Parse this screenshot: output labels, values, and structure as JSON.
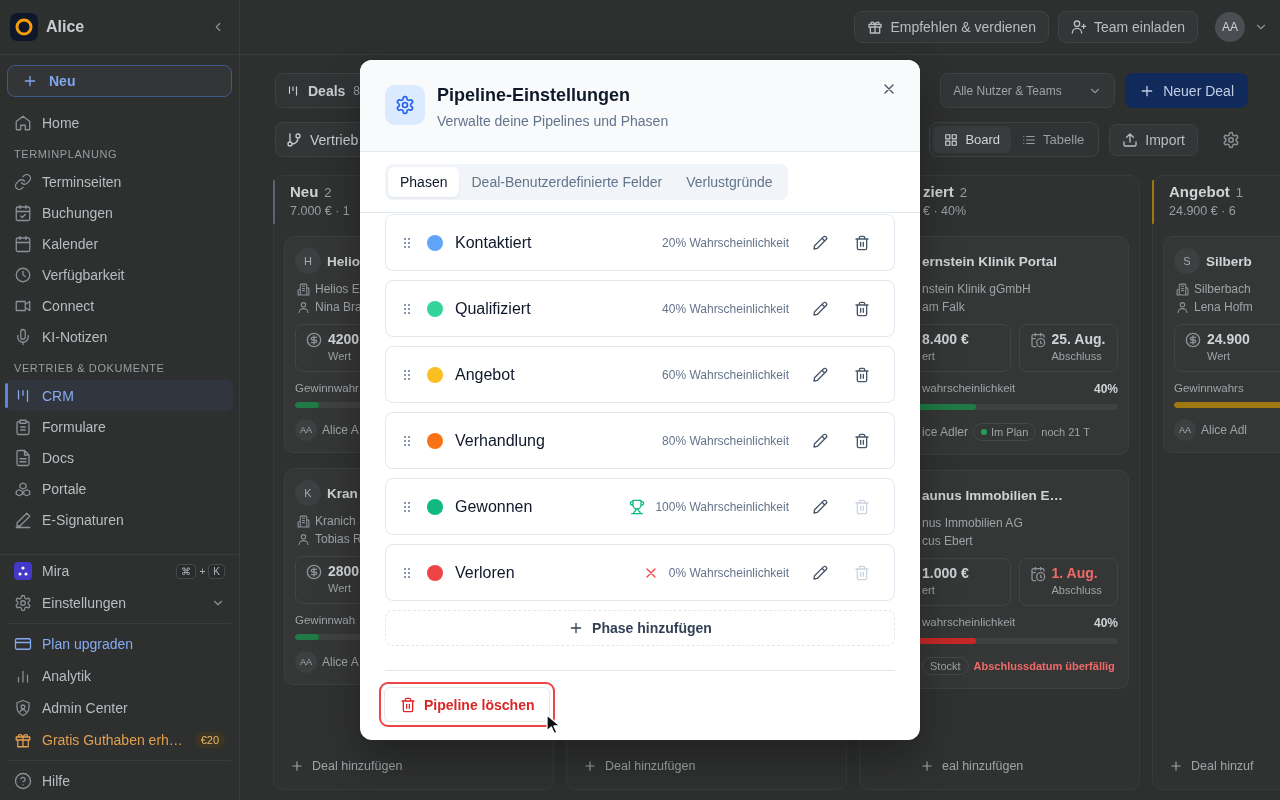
{
  "sidebar": {
    "workspace": "Alice",
    "new_button": "Neu",
    "groups": [
      {
        "items": [
          {
            "label": "Home",
            "selected": false
          }
        ]
      },
      {
        "heading": "TERMINPLANUNG",
        "items": [
          {
            "label": "Terminseiten",
            "selected": false
          },
          {
            "label": "Buchungen",
            "selected": false
          },
          {
            "label": "Kalender",
            "selected": false
          },
          {
            "label": "Verfügbarkeit",
            "selected": false
          },
          {
            "label": "Connect",
            "selected": false
          },
          {
            "label": "KI-Notizen",
            "selected": false
          }
        ]
      },
      {
        "heading": "VERTRIEB & DOKUMENTE",
        "items": [
          {
            "label": "CRM",
            "selected": true
          },
          {
            "label": "Formulare",
            "selected": false
          },
          {
            "label": "Docs",
            "selected": false
          },
          {
            "label": "Portale",
            "selected": false
          },
          {
            "label": "E-Signaturen",
            "selected": false
          }
        ]
      }
    ],
    "assistant": {
      "label": "Mira",
      "shortcut": [
        "⌘",
        "+",
        "K"
      ]
    },
    "settings": "Einstellungen",
    "links": [
      {
        "label": "Plan upgraden",
        "kind": "upgrade"
      },
      {
        "label": "Analytik",
        "kind": "plain"
      },
      {
        "label": "Admin Center",
        "kind": "plain"
      },
      {
        "label": "Gratis Guthaben erh…",
        "kind": "promo",
        "badge": "€20"
      }
    ],
    "help": "Hilfe"
  },
  "header": {
    "buttons": [
      "Empfehlen & verdienen",
      "Team einladen"
    ],
    "avatar": "AA"
  },
  "toolbar": {
    "deals_tab": {
      "label": "Deals",
      "count": "8"
    },
    "pipeline_select": "Vertrieb",
    "owner_filter": "Alle Nutzer & Teams",
    "new_deal": "Neuer Deal",
    "views": [
      {
        "label": "Board",
        "selected": true
      },
      {
        "label": "Tabelle",
        "selected": false
      }
    ],
    "import": "Import"
  },
  "board": {
    "columns": [
      {
        "title": "Neu",
        "count": "2",
        "summary": "7.000 € · 1",
        "color": "#5b6475",
        "cards": [
          {
            "avatar": "H",
            "title": "Helio",
            "company": "Helios E",
            "person": "Nina Bra",
            "metrics": [
              {
                "value": "4200",
                "label": "Wert"
              }
            ],
            "prob_label": "Gewinnwahr",
            "level": 0.1,
            "color": "#1f7a45",
            "footer": {
              "avatar": "AA",
              "owner": "Alice A"
            }
          },
          {
            "avatar": "K",
            "title": "Kran",
            "company": "Kranich",
            "person": "Tobias R",
            "metrics": [
              {
                "value": "2800",
                "label": "Wert"
              }
            ],
            "prob_label": "Gewinnwah",
            "level": 0.1,
            "color": "#1f7a45",
            "footer": {
              "avatar": "AA",
              "owner": "Alice A"
            }
          }
        ],
        "add": "Deal hinzufügen"
      },
      {
        "add": "Deal hinzufügen"
      },
      {
        "cut_left": true,
        "title": "ziert",
        "count": "2",
        "summary": "€ · 40%",
        "cards": [
          {
            "title": "ernstein Klinik Portal",
            "company": "nstein Klinik gGmbH",
            "person": "am Falk",
            "metrics": [
              {
                "value": "8.400 €",
                "label": "ert"
              },
              {
                "value": "25. Aug.",
                "label": "Abschluss",
                "overdue": false
              }
            ],
            "prob_label": "wahrscheinlichkeit",
            "prob_value": "40%",
            "level": 0.4,
            "color": "#1f7a45",
            "footer": {
              "owner": "ice Adler",
              "pill": {
                "label": "Im Plan",
                "color": "#22a05a"
              },
              "note": "noch 21 T",
              "alert": false
            }
          },
          {
            "title": "aunus Immobilien E…",
            "company": "nus Immobilien AG",
            "person": "cus Ebert",
            "metrics": [
              {
                "value": "1.000 €",
                "label": "ert"
              },
              {
                "value": "1. Aug.",
                "label": "Abschluss",
                "overdue": true
              }
            ],
            "prob_label": "wahrscheinlichkeit",
            "prob_value": "40%",
            "level": 0.4,
            "color": "#c62828",
            "footer": {
              "pill": {
                "label": "Stockt"
              },
              "note": "Abschlussdatum überfällig",
              "alert": true
            }
          }
        ],
        "add": "eal hinzufügen"
      },
      {
        "title": "Angebot",
        "count": "1",
        "summary": "24.900 € · 6",
        "color": "#a07812",
        "cards": [
          {
            "avatar": "S",
            "title": "Silberb",
            "company": "Silberbach",
            "person": "Lena Hofm",
            "metrics": [
              {
                "value": "24.900",
                "label": "Wert"
              }
            ],
            "prob_label": "Gewinnwahrs",
            "level": 0.6,
            "color": "#a07812",
            "footer": {
              "avatar": "AA",
              "owner": "Alice Adl"
            }
          }
        ],
        "add": "Deal hinzuf"
      }
    ]
  },
  "modal": {
    "title": "Pipeline-Einstellungen",
    "subtitle": "Verwalte deine Pipelines und Phasen",
    "tabs": [
      {
        "label": "Phasen",
        "selected": true
      },
      {
        "label": "Deal-Benutzerdefinierte Felder",
        "selected": false
      },
      {
        "label": "Verlustgründe",
        "selected": false
      }
    ],
    "phases": [
      {
        "name": "Kontaktiert",
        "kind": "open",
        "color": "#60a5fa",
        "probability": "20% Wahrscheinlichkeit",
        "delete_disabled": false
      },
      {
        "name": "Qualifiziert",
        "kind": "open",
        "color": "#34d399",
        "probability": "40% Wahrscheinlichkeit",
        "delete_disabled": false
      },
      {
        "name": "Angebot",
        "kind": "open",
        "color": "#fbbf24",
        "probability": "60% Wahrscheinlichkeit",
        "delete_disabled": false
      },
      {
        "name": "Verhandlung",
        "kind": "open",
        "color": "#f97316",
        "probability": "80% Wahrscheinlichkeit",
        "delete_disabled": false
      },
      {
        "name": "Gewonnen",
        "color": "#10b981",
        "kind": "won",
        "probability": "100% Wahrscheinlichkeit",
        "delete_disabled": true
      },
      {
        "name": "Verloren",
        "color": "#ef4444",
        "kind": "lost",
        "probability": "0% Wahrscheinlichkeit",
        "delete_disabled": true
      }
    ],
    "add_phase": "Phase hinzufügen",
    "delete_pipeline": {
      "label": "Pipeline löschen",
      "focused": true
    }
  }
}
